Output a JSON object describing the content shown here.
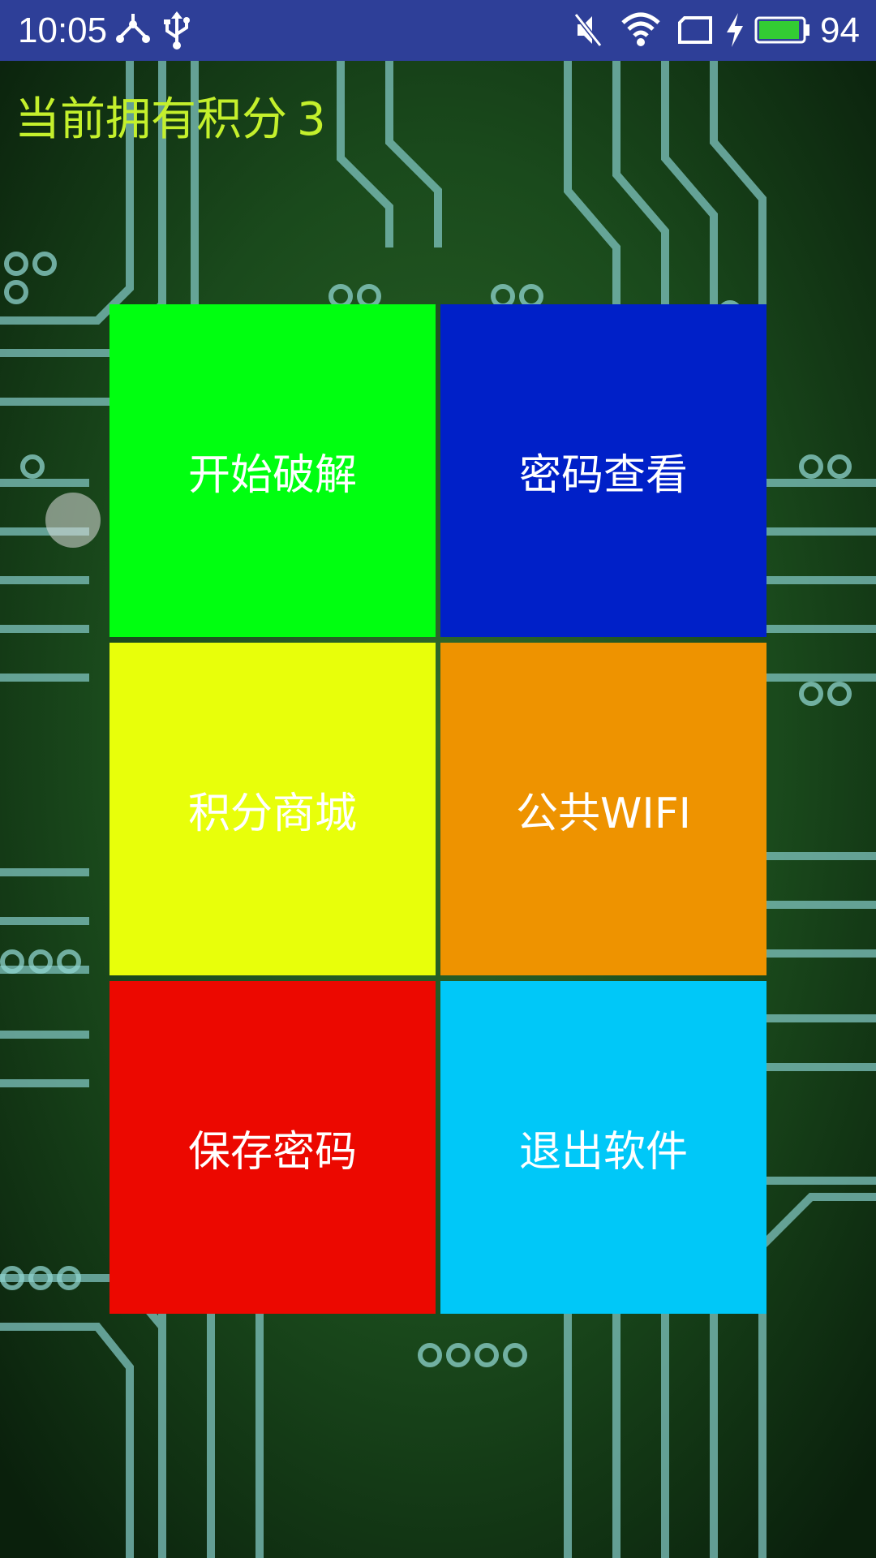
{
  "status_bar": {
    "time": "10:05",
    "battery_level": "94",
    "icons": [
      "usb-tethering-icon",
      "usb-icon",
      "mute-icon",
      "wifi-icon",
      "screen-icon",
      "charging-icon",
      "battery-icon"
    ],
    "battery_color": "#33cc33"
  },
  "header": {
    "points_label": "当前拥有积分",
    "points_value": "3",
    "color": "#c4f02c"
  },
  "menu": {
    "tiles": [
      {
        "label": "开始破解",
        "color": "#00ff10"
      },
      {
        "label": "密码查看",
        "color": "#0020c8"
      },
      {
        "label": "积分商城",
        "color": "#e8ff0a"
      },
      {
        "label": "公共WIFI",
        "color": "#ee9300"
      },
      {
        "label": "保存密码",
        "color": "#ec0800"
      },
      {
        "label": "退出软件",
        "color": "#00c8f8"
      }
    ]
  },
  "background": {
    "description_icon": "circuit-board-background",
    "base_color": "#0c2a0c"
  }
}
